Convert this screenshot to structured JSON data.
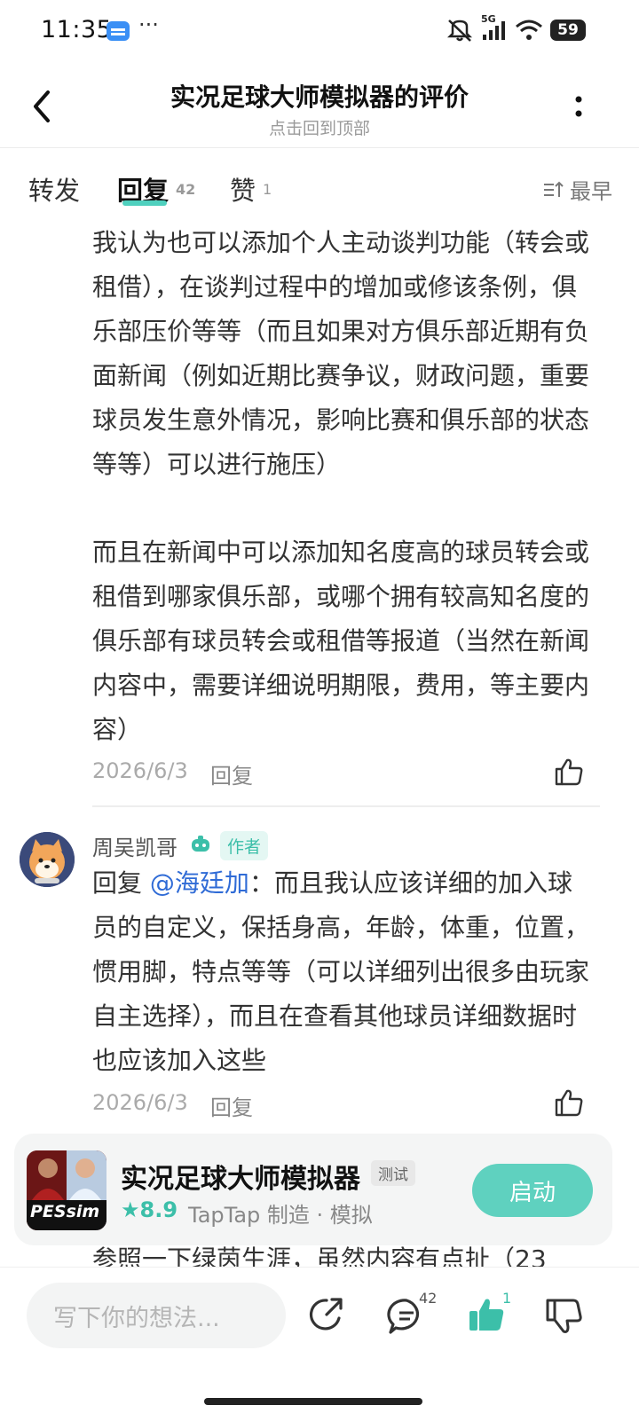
{
  "status_bar": {
    "time": "11:35",
    "dots": "···",
    "network": "5G",
    "battery": "59"
  },
  "header": {
    "title": "实况足球大师模拟器的评价",
    "subtitle": "点击回到顶部"
  },
  "tabs": [
    {
      "label": "转发",
      "count": ""
    },
    {
      "label": "回复",
      "count": "42"
    },
    {
      "label": "赞",
      "count": "1"
    }
  ],
  "sort": {
    "label": "最早"
  },
  "comment1": {
    "text1": "我认为也可以添加个人主动谈判功能（转会或租借），在谈判过程中的增加或修该条例，俱乐部压价等等（而且如果对方俱乐部近期有负面新闻（例如近期比赛争议，财政问题，重要球员发生意外情况，影响比赛和俱乐部的状态等等）可以进行施压）",
    "text2": "而且在新闻中可以添加知名度高的球员转会或租借到哪家俱乐部，或哪个拥有较高知名度的俱乐部有球员转会或租借等报道（当然在新闻内容中，需要详细说明期限，费用，等主要内容）",
    "date": "2026/6/3",
    "reply": "回复"
  },
  "comment2": {
    "author": "周吴凯哥",
    "author_tag": "作者",
    "reply_prefix": "回复",
    "mention": "@海廷加",
    "text": "：而且我认应该详细的加入球员的自定义，保括身高，年龄，体重，位置，惯用脚，特点等等（可以详细列出很多由玩家自主选择），而且在查看其他球员详细数据时也应该加入这些",
    "date": "2026/6/3",
    "reply": "回复"
  },
  "game_card": {
    "name": "实况足球大师模拟器",
    "tag": "测试",
    "rating": "8.9",
    "meta": "TapTap 制造 · 模拟",
    "button": "启动",
    "cover_label": "PESsim"
  },
  "peek_text": "参照一下绿茵生涯，虽然内容有点扯（23",
  "bottom_bar": {
    "input_placeholder": "写下你的想法...",
    "comment_count": "42",
    "like_count": "1"
  },
  "colors": {
    "accent": "#5fd1bf",
    "mention": "#2f6bd6"
  }
}
